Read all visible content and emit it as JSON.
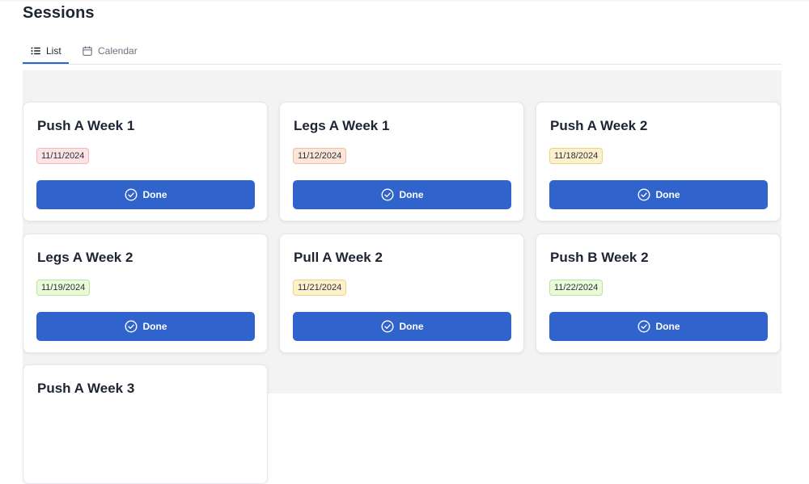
{
  "page": {
    "title": "Sessions"
  },
  "tabs": [
    {
      "label": "List",
      "icon": "list-icon",
      "active": true
    },
    {
      "label": "Calendar",
      "icon": "calendar-icon",
      "active": false
    }
  ],
  "colors": {
    "accent": "#3064cc",
    "content_bg": "#f3f3f4",
    "badge_red": "#fde3e3",
    "badge_orange": "#fde5da",
    "badge_amber": "#fdf0cc",
    "badge_green": "#eafbd9"
  },
  "sessions": [
    {
      "title": "Push A Week 1",
      "date": "11/11/2024",
      "badge_color": "red",
      "button_label": "Done",
      "button_icon": "check-circle-icon"
    },
    {
      "title": "Legs A Week 1",
      "date": "11/12/2024",
      "badge_color": "orange",
      "button_label": "Done",
      "button_icon": "check-circle-icon"
    },
    {
      "title": "Push A Week 2",
      "date": "11/18/2024",
      "badge_color": "amber",
      "button_label": "Done",
      "button_icon": "check-circle-icon"
    },
    {
      "title": "Legs A Week 2",
      "date": "11/19/2024",
      "badge_color": "green",
      "button_label": "Done",
      "button_icon": "check-circle-icon"
    },
    {
      "title": "Pull A Week 2",
      "date": "11/21/2024",
      "badge_color": "amber",
      "button_label": "Done",
      "button_icon": "check-circle-icon"
    },
    {
      "title": "Push B Week 2",
      "date": "11/22/2024",
      "badge_color": "green",
      "button_label": "Done",
      "button_icon": "check-circle-icon"
    },
    {
      "title": "Push A Week 3"
    }
  ]
}
